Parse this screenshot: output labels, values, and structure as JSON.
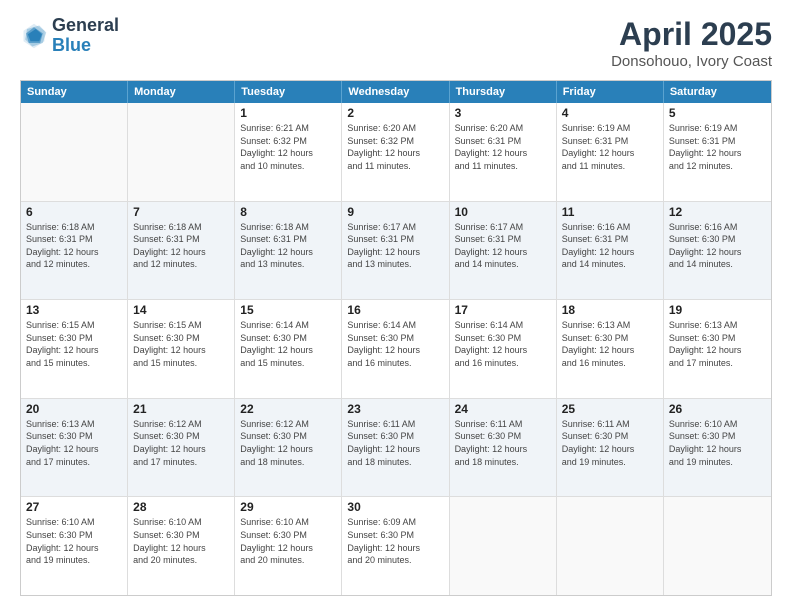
{
  "header": {
    "logo_general": "General",
    "logo_blue": "Blue",
    "title": "April 2025",
    "subtitle": "Donsohouo, Ivory Coast"
  },
  "calendar": {
    "days_of_week": [
      "Sunday",
      "Monday",
      "Tuesday",
      "Wednesday",
      "Thursday",
      "Friday",
      "Saturday"
    ],
    "rows": [
      [
        {
          "day": "",
          "info": ""
        },
        {
          "day": "",
          "info": ""
        },
        {
          "day": "1",
          "info": "Sunrise: 6:21 AM\nSunset: 6:32 PM\nDaylight: 12 hours\nand 10 minutes."
        },
        {
          "day": "2",
          "info": "Sunrise: 6:20 AM\nSunset: 6:32 PM\nDaylight: 12 hours\nand 11 minutes."
        },
        {
          "day": "3",
          "info": "Sunrise: 6:20 AM\nSunset: 6:31 PM\nDaylight: 12 hours\nand 11 minutes."
        },
        {
          "day": "4",
          "info": "Sunrise: 6:19 AM\nSunset: 6:31 PM\nDaylight: 12 hours\nand 11 minutes."
        },
        {
          "day": "5",
          "info": "Sunrise: 6:19 AM\nSunset: 6:31 PM\nDaylight: 12 hours\nand 12 minutes."
        }
      ],
      [
        {
          "day": "6",
          "info": "Sunrise: 6:18 AM\nSunset: 6:31 PM\nDaylight: 12 hours\nand 12 minutes."
        },
        {
          "day": "7",
          "info": "Sunrise: 6:18 AM\nSunset: 6:31 PM\nDaylight: 12 hours\nand 12 minutes."
        },
        {
          "day": "8",
          "info": "Sunrise: 6:18 AM\nSunset: 6:31 PM\nDaylight: 12 hours\nand 13 minutes."
        },
        {
          "day": "9",
          "info": "Sunrise: 6:17 AM\nSunset: 6:31 PM\nDaylight: 12 hours\nand 13 minutes."
        },
        {
          "day": "10",
          "info": "Sunrise: 6:17 AM\nSunset: 6:31 PM\nDaylight: 12 hours\nand 14 minutes."
        },
        {
          "day": "11",
          "info": "Sunrise: 6:16 AM\nSunset: 6:31 PM\nDaylight: 12 hours\nand 14 minutes."
        },
        {
          "day": "12",
          "info": "Sunrise: 6:16 AM\nSunset: 6:30 PM\nDaylight: 12 hours\nand 14 minutes."
        }
      ],
      [
        {
          "day": "13",
          "info": "Sunrise: 6:15 AM\nSunset: 6:30 PM\nDaylight: 12 hours\nand 15 minutes."
        },
        {
          "day": "14",
          "info": "Sunrise: 6:15 AM\nSunset: 6:30 PM\nDaylight: 12 hours\nand 15 minutes."
        },
        {
          "day": "15",
          "info": "Sunrise: 6:14 AM\nSunset: 6:30 PM\nDaylight: 12 hours\nand 15 minutes."
        },
        {
          "day": "16",
          "info": "Sunrise: 6:14 AM\nSunset: 6:30 PM\nDaylight: 12 hours\nand 16 minutes."
        },
        {
          "day": "17",
          "info": "Sunrise: 6:14 AM\nSunset: 6:30 PM\nDaylight: 12 hours\nand 16 minutes."
        },
        {
          "day": "18",
          "info": "Sunrise: 6:13 AM\nSunset: 6:30 PM\nDaylight: 12 hours\nand 16 minutes."
        },
        {
          "day": "19",
          "info": "Sunrise: 6:13 AM\nSunset: 6:30 PM\nDaylight: 12 hours\nand 17 minutes."
        }
      ],
      [
        {
          "day": "20",
          "info": "Sunrise: 6:13 AM\nSunset: 6:30 PM\nDaylight: 12 hours\nand 17 minutes."
        },
        {
          "day": "21",
          "info": "Sunrise: 6:12 AM\nSunset: 6:30 PM\nDaylight: 12 hours\nand 17 minutes."
        },
        {
          "day": "22",
          "info": "Sunrise: 6:12 AM\nSunset: 6:30 PM\nDaylight: 12 hours\nand 18 minutes."
        },
        {
          "day": "23",
          "info": "Sunrise: 6:11 AM\nSunset: 6:30 PM\nDaylight: 12 hours\nand 18 minutes."
        },
        {
          "day": "24",
          "info": "Sunrise: 6:11 AM\nSunset: 6:30 PM\nDaylight: 12 hours\nand 18 minutes."
        },
        {
          "day": "25",
          "info": "Sunrise: 6:11 AM\nSunset: 6:30 PM\nDaylight: 12 hours\nand 19 minutes."
        },
        {
          "day": "26",
          "info": "Sunrise: 6:10 AM\nSunset: 6:30 PM\nDaylight: 12 hours\nand 19 minutes."
        }
      ],
      [
        {
          "day": "27",
          "info": "Sunrise: 6:10 AM\nSunset: 6:30 PM\nDaylight: 12 hours\nand 19 minutes."
        },
        {
          "day": "28",
          "info": "Sunrise: 6:10 AM\nSunset: 6:30 PM\nDaylight: 12 hours\nand 20 minutes."
        },
        {
          "day": "29",
          "info": "Sunrise: 6:10 AM\nSunset: 6:30 PM\nDaylight: 12 hours\nand 20 minutes."
        },
        {
          "day": "30",
          "info": "Sunrise: 6:09 AM\nSunset: 6:30 PM\nDaylight: 12 hours\nand 20 minutes."
        },
        {
          "day": "",
          "info": ""
        },
        {
          "day": "",
          "info": ""
        },
        {
          "day": "",
          "info": ""
        }
      ]
    ]
  }
}
